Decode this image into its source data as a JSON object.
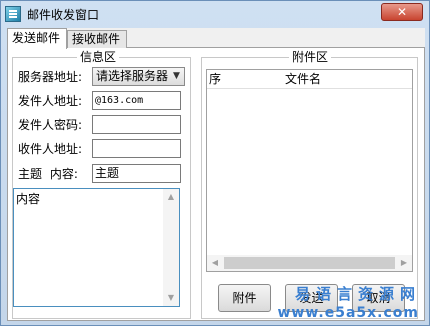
{
  "window": {
    "title": "邮件收发窗口",
    "close_label": "✕"
  },
  "tabs": [
    {
      "label": "发送邮件",
      "active": true
    },
    {
      "label": "接收邮件",
      "active": false
    }
  ],
  "info_group": {
    "title": "信息区",
    "server_label": "服务器地址:",
    "server_selected": "请选择服务器",
    "sender_label": "发件人地址:",
    "sender_value": "@163.com",
    "password_label": "发件人密码:",
    "password_value": "",
    "recipient_label": "收件人地址:",
    "recipient_value": "",
    "subject_label": "主题  内容:",
    "subject_value": "主题",
    "content_value": "内容"
  },
  "attach_group": {
    "title": "附件区",
    "columns": [
      "序",
      "文件名"
    ]
  },
  "buttons": {
    "attach": "附件",
    "send": "发送",
    "cancel": "取消"
  },
  "watermark": {
    "line1": "易语言资源网",
    "line2": "www.e5a5x.com"
  },
  "colors": {
    "title_bar": "#c9d9ec",
    "close_button": "#c8442f",
    "content_border": "#4a8fbf",
    "watermark": "#3a7fd0"
  }
}
